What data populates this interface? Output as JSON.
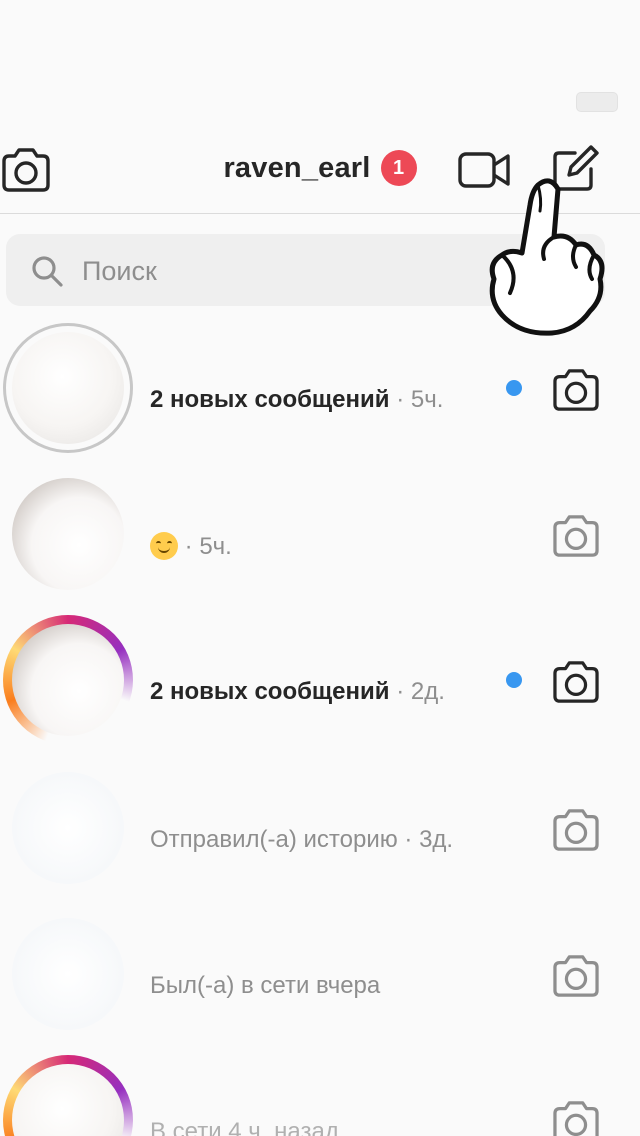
{
  "header": {
    "title": "raven_earl",
    "badge_count": "1"
  },
  "search": {
    "placeholder": "Поиск"
  },
  "conversations": [
    {
      "name": "",
      "preview": "2 новых сообщений",
      "preview_bold": true,
      "time": " · 5ч.",
      "unread": true,
      "camera_active": true
    },
    {
      "name": "",
      "preview": "",
      "emoji": "smiling-face",
      "preview_bold": false,
      "time": " · 5ч.",
      "unread": false,
      "camera_active": false
    },
    {
      "name": "",
      "preview": "2 новых сообщений",
      "preview_bold": true,
      "time": " · 2д.",
      "unread": true,
      "camera_active": true
    },
    {
      "name": "",
      "preview": "Отправил(-а) историю",
      "preview_bold": false,
      "time": " · 3д.",
      "unread": false,
      "camera_active": false
    },
    {
      "name": "",
      "preview": "Был(-а) в сети вчера",
      "preview_bold": false,
      "time": "",
      "unread": false,
      "camera_active": false
    },
    {
      "name": "",
      "preview": "В сети 4 ч. назад",
      "preview_bold": false,
      "time": "",
      "unread": false,
      "camera_active": false
    }
  ],
  "colors": {
    "badge": "#ed4956",
    "unread_dot": "#3897f0",
    "text_primary": "#262626",
    "text_secondary": "#8e8e8e"
  },
  "icons": [
    "camera-icon",
    "video-call-icon",
    "compose-icon",
    "search-icon",
    "pointing-hand-sticker"
  ]
}
